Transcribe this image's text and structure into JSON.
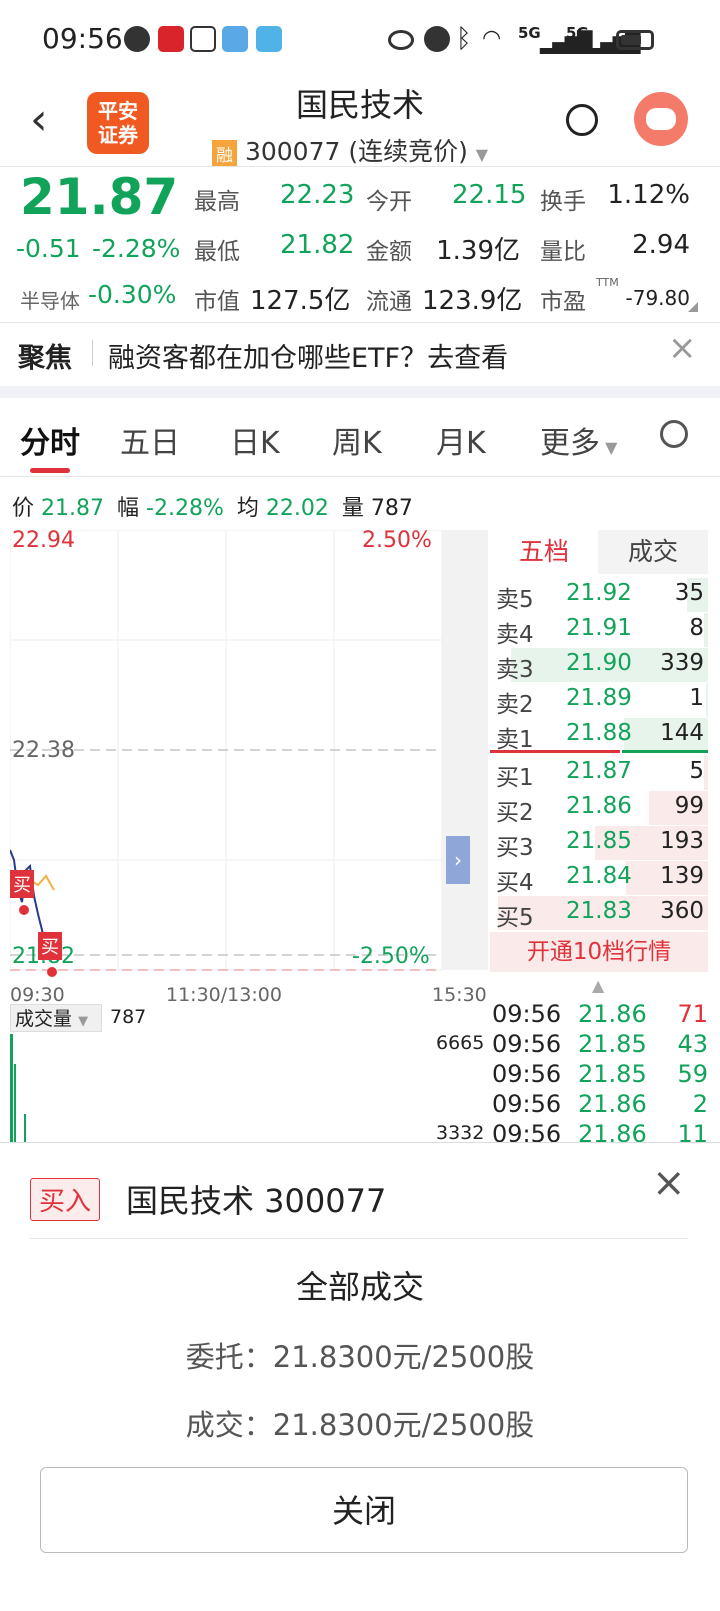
{
  "status_bar": {
    "time": "09:56",
    "net1": "5G",
    "net2": "5G"
  },
  "header": {
    "logo_line1": "平安",
    "logo_line2": "证券",
    "stock_name": "国民技术",
    "badge": "融",
    "code_line": "300077 (连续竞价)"
  },
  "quote": {
    "price": "21.87",
    "change": "-0.51",
    "change_pct": "-2.28%",
    "sector_label": "半导体",
    "sector_pct": "-0.30%",
    "high_label": "最高",
    "high": "22.23",
    "open_label": "今开",
    "open": "22.15",
    "turnover_label": "换手",
    "turnover": "1.12%",
    "low_label": "最低",
    "low": "21.82",
    "amount_label": "金额",
    "amount": "1.39亿",
    "vol_ratio_label": "量比",
    "vol_ratio": "2.94",
    "mcap_label": "市值",
    "mcap": "127.5亿",
    "float_label": "流通",
    "float": "123.9亿",
    "pe_label": "市盈",
    "pe_tag": "TTM",
    "pe": "-79.80"
  },
  "focus": {
    "label": "聚焦",
    "text": "融资客都在加仓哪些ETF？去查看"
  },
  "tabs": [
    "分时",
    "五日",
    "日K",
    "周K",
    "月K",
    "更多"
  ],
  "info_line": {
    "price_label": "价",
    "price": "21.87",
    "range_label": "幅",
    "range": "-2.28%",
    "avg_label": "均",
    "avg": "22.02",
    "vol_label": "量",
    "vol": "787"
  },
  "chart": {
    "y_top": "22.94",
    "y_mid": "22.38",
    "y_bottom": "21.82",
    "pct_top": "2.50%",
    "pct_bottom": "-2.50%",
    "t_start": "09:30",
    "t_mid": "11:30/13:00",
    "t_end": "15:30",
    "buy_marker": "买",
    "vol_label": "成交量",
    "vol_value": "787",
    "vol_max": "6665",
    "vol_mid": "3332"
  },
  "order_book": {
    "tab_five": "五档",
    "tab_deal": "成交",
    "asks": [
      {
        "label": "卖5",
        "price": "21.92",
        "vol": "35"
      },
      {
        "label": "卖4",
        "price": "21.91",
        "vol": "8"
      },
      {
        "label": "卖3",
        "price": "21.90",
        "vol": "339"
      },
      {
        "label": "卖2",
        "price": "21.89",
        "vol": "1"
      },
      {
        "label": "卖1",
        "price": "21.88",
        "vol": "144"
      }
    ],
    "bids": [
      {
        "label": "买1",
        "price": "21.87",
        "vol": "5"
      },
      {
        "label": "买2",
        "price": "21.86",
        "vol": "99"
      },
      {
        "label": "买3",
        "price": "21.85",
        "vol": "193"
      },
      {
        "label": "买4",
        "price": "21.84",
        "vol": "139"
      },
      {
        "label": "买5",
        "price": "21.83",
        "vol": "360"
      }
    ],
    "open_ten": "开通10档行情"
  },
  "trades": [
    {
      "time": "09:56",
      "price": "21.86",
      "vol": "71"
    },
    {
      "time": "09:56",
      "price": "21.85",
      "vol": "43"
    },
    {
      "time": "09:56",
      "price": "21.85",
      "vol": "59"
    },
    {
      "time": "09:56",
      "price": "21.86",
      "vol": "2"
    },
    {
      "time": "09:56",
      "price": "21.86",
      "vol": "11"
    }
  ],
  "popup": {
    "tag": "买入",
    "title": "国民技术 300077",
    "status": "全部成交",
    "order_line": "委托：21.8300元/2500股",
    "deal_line": "成交：21.8300元/2500股",
    "close_button": "关闭"
  },
  "colors": {
    "green": "#12a35a",
    "red": "#e0323a",
    "orange": "#f05a22"
  }
}
